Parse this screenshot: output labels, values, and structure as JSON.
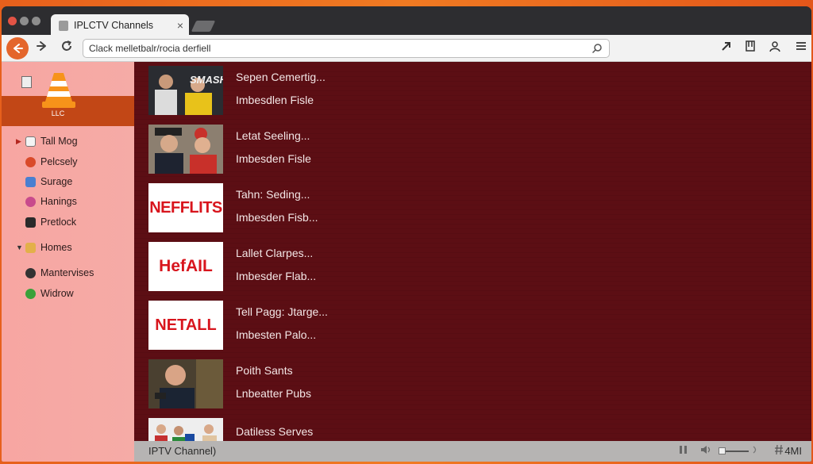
{
  "tab": {
    "title": "IPLCTV Channels",
    "close": "×"
  },
  "toolbar": {
    "url": "Clack melletbalr/rocia derfiell"
  },
  "sidebar": {
    "logo_label": "LLC",
    "items": [
      {
        "label": "Tall Mog",
        "arrow": "▶",
        "icon_color": "#f4f4f4"
      },
      {
        "label": "Pelcsely",
        "arrow": "",
        "icon_color": "#d94a2a"
      },
      {
        "label": "Surage",
        "arrow": "",
        "icon_color": "#4a7fd0"
      },
      {
        "label": "Hanings",
        "arrow": "",
        "icon_color": "#c84a8c"
      },
      {
        "label": "Pretlock",
        "arrow": "",
        "icon_color": "#2a2a2a"
      },
      {
        "label": "Homes",
        "arrow": "▼",
        "icon_color": "#e3b04a"
      },
      {
        "label": "Mantervises",
        "arrow": "",
        "icon_color": "#333333"
      },
      {
        "label": "Widrow",
        "arrow": "",
        "icon_color": "#3aa13a"
      }
    ]
  },
  "channels": [
    {
      "title": "Sepen Cemertig...",
      "subtitle": "Imbesdlen Fisle",
      "thumb_text": "SMASH"
    },
    {
      "title": "Letat Seeling...",
      "subtitle": "Imbesden Fisle",
      "thumb_text": ""
    },
    {
      "title": "Tahn: Seding...",
      "subtitle": "Imbesden Fisb...",
      "thumb_text": "NEFFLITS"
    },
    {
      "title": "Lallet Clarpes...",
      "subtitle": "Imbesder Flab...",
      "thumb_text": "HefAIL"
    },
    {
      "title": "Tell Pagg: Jtarge...",
      "subtitle": "Imbesten Palo...",
      "thumb_text": "NETALL"
    },
    {
      "title": "Poith Sants",
      "subtitle": "Lnbeatter Pubs",
      "thumb_text": ""
    },
    {
      "title": "Datiless Serves",
      "subtitle": "",
      "thumb_text": ""
    }
  ],
  "status": {
    "label": "IPTV Channel)",
    "right": "4MI"
  },
  "colors": {
    "accent": "#e4662c",
    "main_bg": "#5c0e14",
    "sidebar_bg": "#f7a6a2",
    "netflix_red": "#d8151d"
  }
}
